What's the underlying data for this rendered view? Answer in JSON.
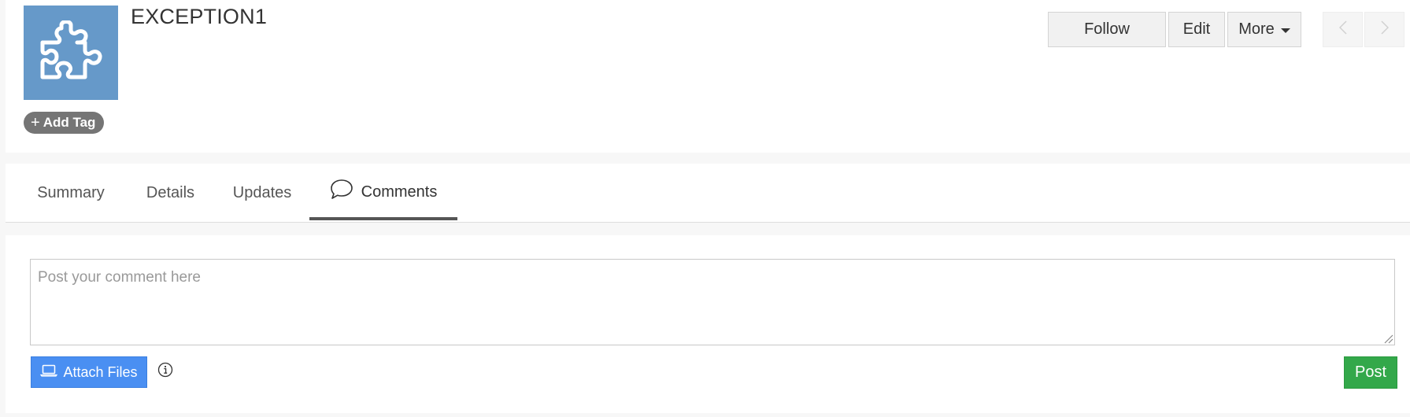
{
  "record": {
    "title": "EXCEPTION1",
    "avatar_icon": "puzzle-piece-icon",
    "avatar_color": "#6699c9"
  },
  "tag": {
    "add_label": "Add Tag",
    "icon": "plus-icon"
  },
  "toolbar": {
    "follow_label": "Follow",
    "edit_label": "Edit",
    "more_label": "More",
    "prev_icon": "chevron-left-icon",
    "next_icon": "chevron-right-icon"
  },
  "tabs": [
    {
      "label": "Summary",
      "active": false
    },
    {
      "label": "Details",
      "active": false
    },
    {
      "label": "Updates",
      "active": false
    },
    {
      "label": "Comments",
      "active": true,
      "icon": "speech-bubble-icon"
    }
  ],
  "comments": {
    "placeholder": "Post your comment here",
    "value": "",
    "attach_label": "Attach Files",
    "attach_icon": "laptop-icon",
    "info_icon": "info-icon",
    "post_label": "Post",
    "attach_color": "#4a8ff2",
    "post_color": "#33a84a"
  }
}
